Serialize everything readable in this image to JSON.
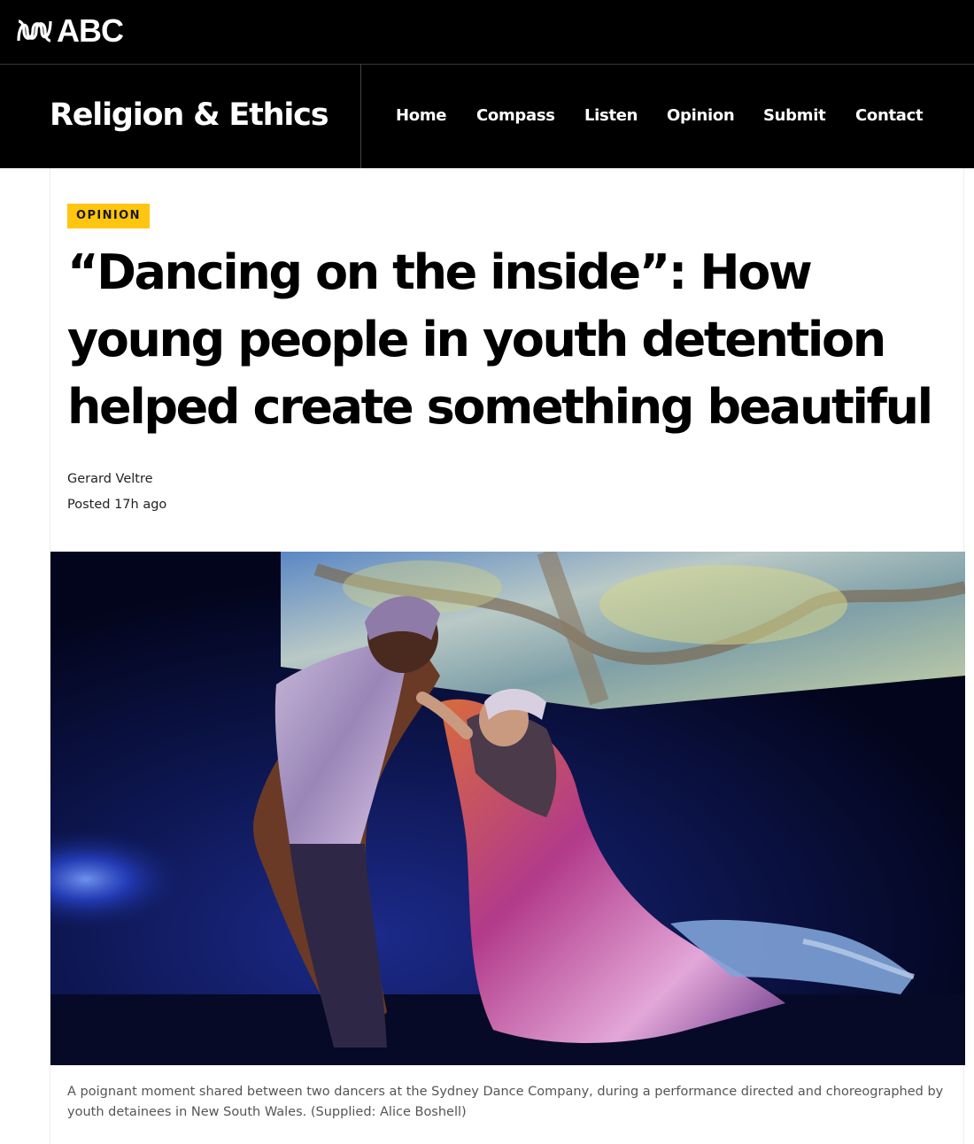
{
  "brand": {
    "logo_text": "ABC"
  },
  "header": {
    "section_title": "Religion & Ethics",
    "nav": [
      "Home",
      "Compass",
      "Listen",
      "Opinion",
      "Submit",
      "Contact"
    ]
  },
  "article": {
    "label": "OPINION",
    "headline": "“Dancing on the inside”: How young people in youth detention helped create something beautiful",
    "author": "Gerard Veltre",
    "posted": "Posted 17h ago",
    "image_caption": "A poignant moment shared between two dancers at the Sydney Dance Company, during a performance directed and choreographed by youth detainees in New South Wales. (Supplied: Alice Boshell)"
  },
  "colors": {
    "header_bg": "#000000",
    "badge_bg": "#ffc510",
    "header_text": "#ffffff"
  }
}
